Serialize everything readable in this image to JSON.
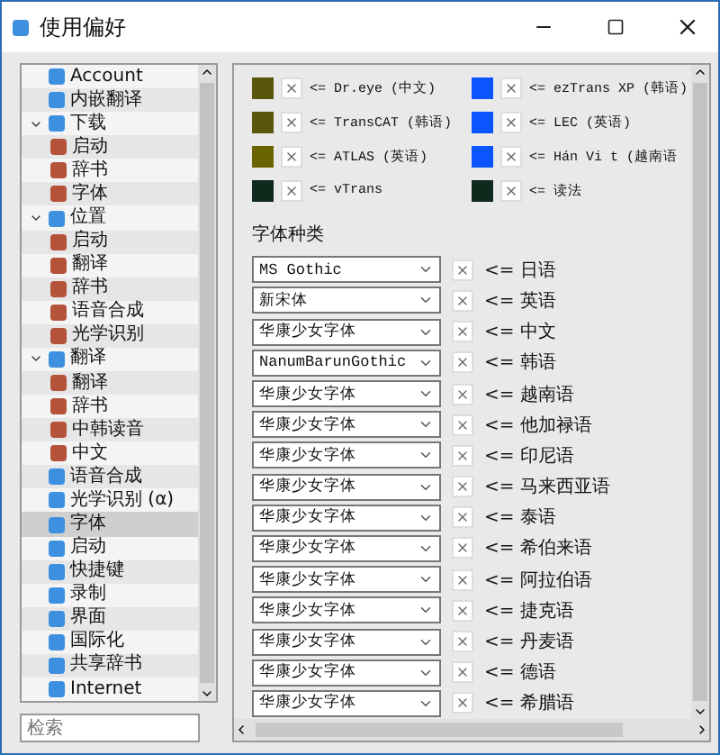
{
  "window": {
    "title": "使用偏好"
  },
  "sidebar": {
    "items": [
      {
        "label": "Account",
        "selected": false
      },
      {
        "label": "内嵌翻译",
        "selected": false
      },
      {
        "label": "下载",
        "selected": false,
        "expanded": true,
        "children": [
          {
            "label": "启动",
            "selected": false
          },
          {
            "label": "辞书",
            "selected": false
          },
          {
            "label": "字体",
            "selected": false
          }
        ]
      },
      {
        "label": "位置",
        "selected": false,
        "expanded": true,
        "children": [
          {
            "label": "启动",
            "selected": false
          },
          {
            "label": "翻译",
            "selected": false
          },
          {
            "label": "辞书",
            "selected": false
          },
          {
            "label": "语音合成",
            "selected": false
          },
          {
            "label": "光学识别",
            "selected": false
          }
        ]
      },
      {
        "label": "翻译",
        "selected": false,
        "expanded": true,
        "children": [
          {
            "label": "翻译",
            "selected": false
          },
          {
            "label": "辞书",
            "selected": false
          },
          {
            "label": "中韩读音",
            "selected": false
          },
          {
            "label": "中文",
            "selected": false
          }
        ]
      },
      {
        "label": "语音合成",
        "selected": false
      },
      {
        "label": "光学识别 (α)",
        "selected": false
      },
      {
        "label": "字体",
        "selected": true
      },
      {
        "label": "启动",
        "selected": false
      },
      {
        "label": "快捷键",
        "selected": false
      },
      {
        "label": "录制",
        "selected": false
      },
      {
        "label": "界面",
        "selected": false
      },
      {
        "label": "国际化",
        "selected": false
      },
      {
        "label": "共享辞书",
        "selected": false
      },
      {
        "label": "Internet",
        "selected": false
      }
    ]
  },
  "search": {
    "placeholder": "检索"
  },
  "color_rows": [
    {
      "left": {
        "color": "#5a560c",
        "label": "<= Dr.eye (中文)"
      },
      "right": {
        "color": "#0a55ff",
        "label": "<= ezTrans XP (韩语)"
      }
    },
    {
      "left": {
        "color": "#5a560c",
        "label": "<= TransCAT (韩语)"
      },
      "right": {
        "color": "#0a55ff",
        "label": "<= LEC (英语)"
      }
    },
    {
      "left": {
        "color": "#6a6400",
        "label": "<= ATLAS (英语)"
      },
      "right": {
        "color": "#0a55ff",
        "label": "<= Hán Vi t (越南语"
      }
    },
    {
      "left": {
        "color": "#0f2a1c",
        "label": "<= vTrans"
      },
      "right": {
        "color": "#0f2a1c",
        "label": "<= 读法"
      }
    }
  ],
  "font_section": {
    "title": "字体种类",
    "rows": [
      {
        "font": "MS Gothic",
        "language": "<= 日语"
      },
      {
        "font": "新宋体",
        "language": "<= 英语"
      },
      {
        "font": "华康少女字体",
        "language": "<= 中文"
      },
      {
        "font": "NanumBarunGothic",
        "language": "<= 韩语"
      },
      {
        "font": "华康少女字体",
        "language": "<= 越南语"
      },
      {
        "font": "华康少女字体",
        "language": "<= 他加禄语"
      },
      {
        "font": "华康少女字体",
        "language": "<= 印尼语"
      },
      {
        "font": "华康少女字体",
        "language": "<= 马来西亚语"
      },
      {
        "font": "华康少女字体",
        "language": "<= 泰语"
      },
      {
        "font": "华康少女字体",
        "language": "<= 希伯来语"
      },
      {
        "font": "华康少女字体",
        "language": "<= 阿拉伯语"
      },
      {
        "font": "华康少女字体",
        "language": "<= 捷克语"
      },
      {
        "font": "华康少女字体",
        "language": "<= 丹麦语"
      },
      {
        "font": "华康少女字体",
        "language": "<= 德语"
      },
      {
        "font": "华康少女字体",
        "language": "<= 希腊语"
      }
    ]
  }
}
